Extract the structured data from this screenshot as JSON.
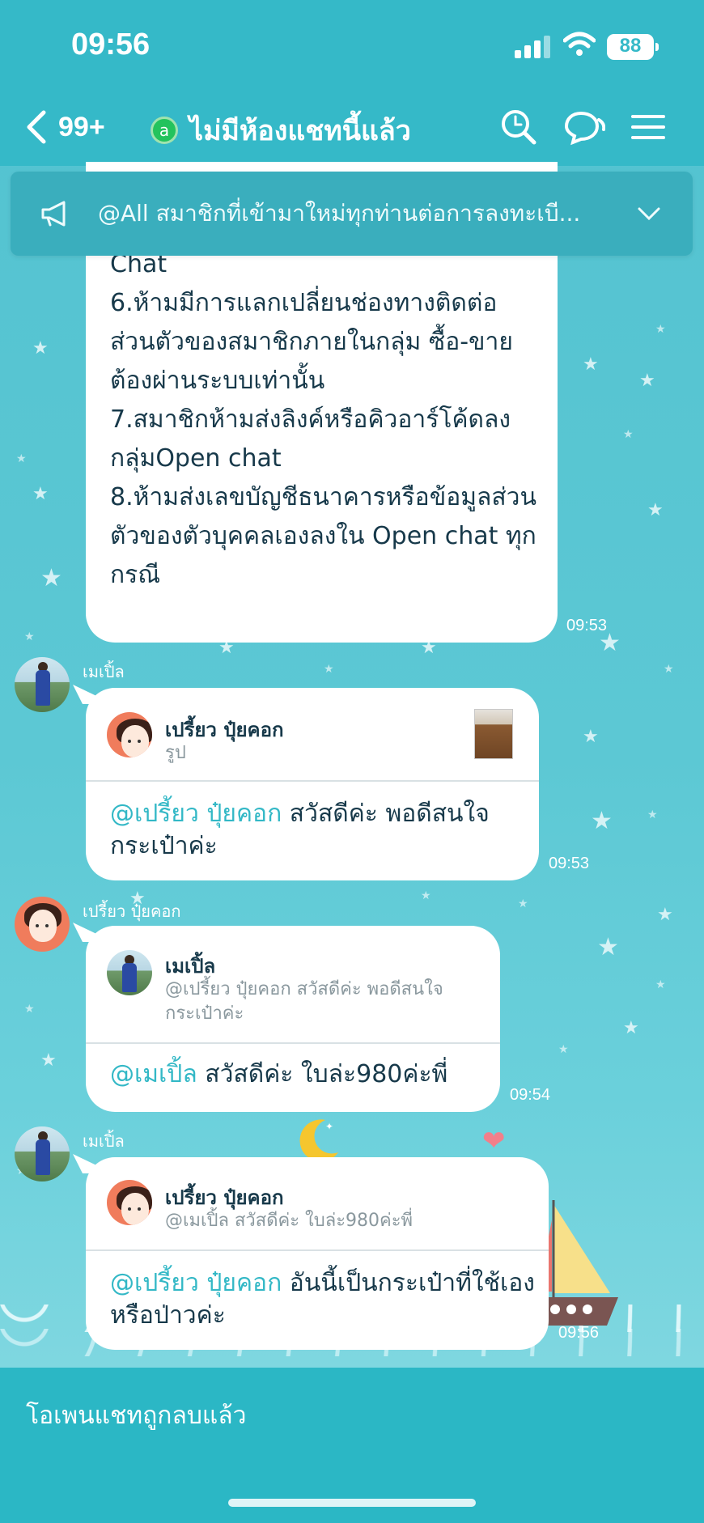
{
  "status_bar": {
    "time": "09:56",
    "battery": "88"
  },
  "header": {
    "back_count": "99+",
    "open_chat_badge": "a",
    "title": "ไม่มีห้องแชทนี้แล้ว",
    "icons": [
      "search-icon",
      "chat-bubbles-icon",
      "menu-icon"
    ]
  },
  "announcement": {
    "text": "@All สมาชิกที่เข้ามาใหม่ทุกท่านต่อการลงทะเบี...",
    "icons": [
      "megaphone-icon",
      "chevron-down-icon"
    ]
  },
  "messages": [
    {
      "type": "text",
      "text": "Chat\n6.ห้ามมีการแลกเปลี่ยนช่องทางติดต่อส่วนตัวของสมาชิกภายในกลุ่ม ซื้อ-ขาย ต้องผ่านระบบเท่านั้น\n7.สมาชิกห้ามส่งลิงค์หรือคิวอาร์โค้ดลงกลุ่มOpen chat\n8.ห้ามส่งเลขบัญชีธนาคารหรือข้อมูลส่วนตัวของตัวบุคคลเองลงใน Open chat ทุกกรณี",
      "time": "09:53"
    },
    {
      "type": "reply",
      "sender": "เมเปิ้ล",
      "reply_to_name": "เปรี้ยว ปุ๋ยคอก",
      "reply_to_preview": "รูป",
      "mention": "@เปรี้ยว ปุ๋ยคอก",
      "text": " สวัสดีค่ะ พอดีสนใจกระเป๋าค่ะ",
      "time": "09:53"
    },
    {
      "type": "reply",
      "sender": "เปรี้ยว ปุ๋ยคอก",
      "reply_to_name": "เมเปิ้ล",
      "reply_to_preview": "@เปรี้ยว ปุ๋ยคอก สวัสดีค่ะ พอดีสนใจกระเป๋าค่ะ",
      "mention": "@เมเปิ้ล",
      "text": " สวัสดีค่ะ ใบล่ะ980ค่ะพี่",
      "time": "09:54"
    },
    {
      "type": "reply",
      "sender": "เมเปิ้ล",
      "reply_to_name": "เปรี้ยว ปุ๋ยคอก",
      "reply_to_preview": "@เมเปิ้ล สวัสดีค่ะ ใบล่ะ980ค่ะพี่",
      "mention": "@เปรี้ยว ปุ๋ยคอก",
      "text": " อันนี้เป็นกระเป๋าที่ใช้เองหรือป่าวค่ะ",
      "time": "09:56"
    }
  ],
  "footer": {
    "text": "โอเพนแชทถูกลบแล้ว"
  },
  "colors": {
    "header": "#35b9c8",
    "mention": "#33b8c6",
    "background": "#52c2d0",
    "footer": "#2bb7c5"
  }
}
